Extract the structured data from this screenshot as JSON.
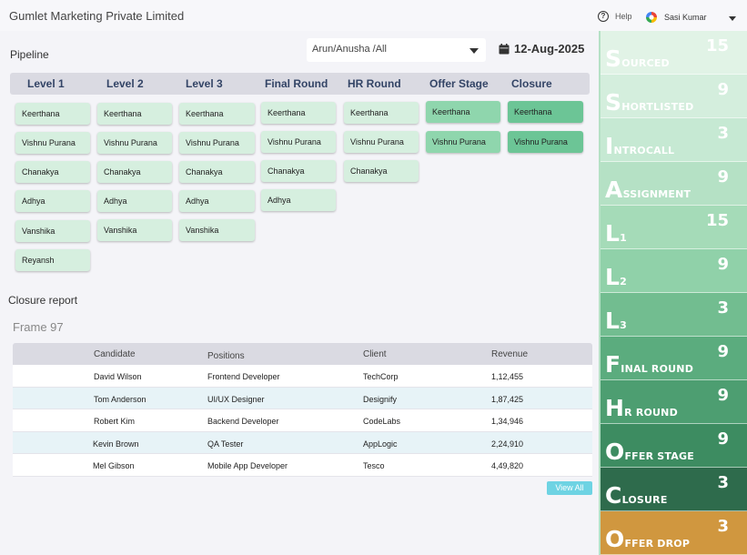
{
  "header": {
    "company": "Gumlet Marketing Private Limited",
    "help_label": "Help",
    "user_name": "Sasi Kumar"
  },
  "pipeline": {
    "title": "Pipeline",
    "recruiter_select": "Arun/Anusha /All",
    "date": "12-Aug-2025",
    "stages": [
      {
        "label": "Level 1",
        "candidates": [
          "Keerthana",
          "Vishnu Purana",
          "Chanakya",
          "Adhya",
          "Vanshika",
          "Reyansh"
        ]
      },
      {
        "label": "Level 2",
        "candidates": [
          "Keerthana",
          "Vishnu Purana",
          "Chanakya",
          "Adhya",
          "Vanshika"
        ]
      },
      {
        "label": "Level 3",
        "candidates": [
          "Keerthana",
          "Vishnu Purana",
          "Chanakya",
          "Adhya",
          "Vanshika"
        ]
      },
      {
        "label": "Final Round",
        "candidates": [
          "Keerthana",
          "Vishnu Purana",
          "Chanakya",
          "Adhya"
        ]
      },
      {
        "label": "HR Round",
        "candidates": [
          "Keerthana",
          "Vishnu Purana",
          "Chanakya"
        ]
      },
      {
        "label": "Offer Stage",
        "candidates": [
          "Keerthana",
          "Vishnu Purana"
        ]
      },
      {
        "label": "Closure",
        "candidates": [
          "Keerthana",
          "Vishnu Purana"
        ]
      }
    ]
  },
  "closure_report": {
    "title": "Closure  report",
    "frame_label": "Frame 97",
    "columns": [
      "Candidate",
      "Positions",
      "Client",
      "Revenue"
    ],
    "rows": [
      [
        "David Wilson",
        "Frontend Developer",
        "TechCorp",
        "1,12,455"
      ],
      [
        "Tom Anderson",
        "UI/UX Designer",
        "Designify",
        "1,87,425"
      ],
      [
        "Robert Kim",
        "Backend Developer",
        "CodeLabs",
        "1,34,946"
      ],
      [
        "Kevin Brown",
        "QA Tester",
        "AppLogic",
        "2,24,910"
      ],
      [
        "Mel Gibson",
        "Mobile App Developer",
        "Tesco",
        "4,49,820"
      ]
    ],
    "view_all_label": "View All"
  },
  "summary_tiles": [
    {
      "initial": "S",
      "rest": "OURCED",
      "count": "15",
      "color": "#e1f3e6"
    },
    {
      "initial": "S",
      "rest": "HORTLISTED",
      "count": "9",
      "color": "#d4eedd"
    },
    {
      "initial": "I",
      "rest": "NTROCALL",
      "count": "3",
      "color": "#c6e9d3"
    },
    {
      "initial": "A",
      "rest": "SSIGNMENT",
      "count": "9",
      "color": "#b5e1c5"
    },
    {
      "initial": "L",
      "rest": "1",
      "count": "15",
      "color": "#a5dbb8"
    },
    {
      "initial": "L",
      "rest": "2",
      "count": "9",
      "color": "#90d1a9"
    },
    {
      "initial": "L",
      "rest": "3",
      "count": "3",
      "color": "#72bd90"
    },
    {
      "initial": "F",
      "rest": "INAL ROUND",
      "count": "9",
      "color": "#5bac7e"
    },
    {
      "initial": "H",
      "rest": "R ROUND",
      "count": "9",
      "color": "#4d9e71"
    },
    {
      "initial": "O",
      "rest": "FFER STAGE",
      "count": "9",
      "color": "#3d8c61"
    },
    {
      "initial": "C",
      "rest": "LOSURE",
      "count": "3",
      "color": "#2e6b4c"
    },
    {
      "initial": "O",
      "rest": "FFER DROP",
      "count": "3",
      "color": "#d0973f"
    }
  ]
}
